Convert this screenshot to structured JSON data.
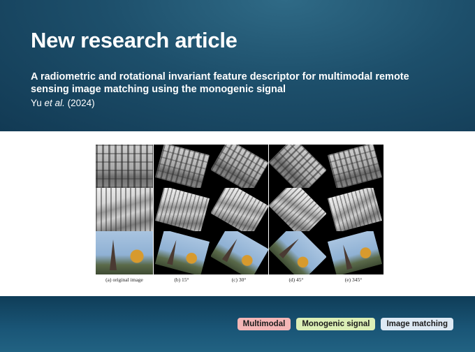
{
  "header": {
    "title": "New research article",
    "subtitle": "A radiometric and rotational invariant feature descriptor for multimodal remote sensing image matching using the monogenic signal",
    "citation_author": "Yu",
    "citation_etal": "et al.",
    "citation_year": "(2024)"
  },
  "figure": {
    "captions": [
      "(a) original image",
      "(b) 15°",
      "(c) 30°",
      "(d) 45°",
      "(e) 345°"
    ],
    "rotations_deg": [
      0,
      15,
      30,
      45,
      345
    ],
    "rows": [
      "building-front",
      "building-side",
      "dome-and-spire"
    ]
  },
  "tags": [
    {
      "label": "Multimodal",
      "color": "#f4b6b6"
    },
    {
      "label": "Monogenic signal",
      "color": "#dcefb6"
    },
    {
      "label": "Image matching",
      "color": "#dde9f4"
    }
  ]
}
